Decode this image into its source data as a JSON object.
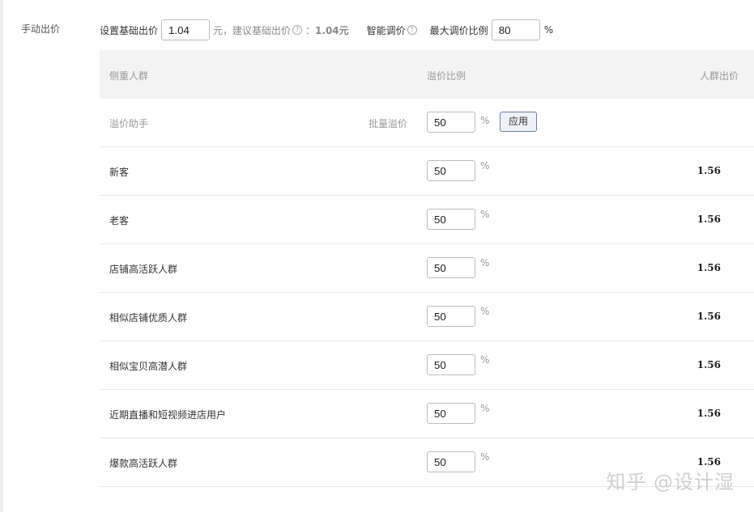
{
  "section_label": "手动出价",
  "base_bid": {
    "label": "设置基础出价",
    "value": "1.04",
    "unit_text": "元，建议基础出价",
    "help_glyph": "?",
    "suggest_sep": "：",
    "suggest_value": "1.04元"
  },
  "smart_adjust": {
    "label": "智能调价",
    "help_glyph": "?"
  },
  "max_ratio": {
    "label": "最大调价比例",
    "value": "80",
    "unit": "%"
  },
  "table": {
    "headers": {
      "group": "侧重人群",
      "ratio": "溢价比例",
      "price": "人群出价"
    },
    "assistant": {
      "label": "溢价助手",
      "batch_label": "批量溢价",
      "value": "50",
      "unit": "%",
      "apply_label": "应用"
    },
    "rows": [
      {
        "name": "新客",
        "ratio": "50",
        "unit": "%",
        "price": "1.56"
      },
      {
        "name": "老客",
        "ratio": "50",
        "unit": "%",
        "price": "1.56"
      },
      {
        "name": "店铺高活跃人群",
        "ratio": "50",
        "unit": "%",
        "price": "1.56"
      },
      {
        "name": "相似店铺优质人群",
        "ratio": "50",
        "unit": "%",
        "price": "1.56"
      },
      {
        "name": "相似宝贝高潜人群",
        "ratio": "50",
        "unit": "%",
        "price": "1.56"
      },
      {
        "name": "近期直播和短视频进店用户",
        "ratio": "50",
        "unit": "%",
        "price": "1.56"
      },
      {
        "name": "爆款高活跃人群",
        "ratio": "50",
        "unit": "%",
        "price": "1.56"
      }
    ]
  },
  "watermark": "知乎 @设计湿"
}
